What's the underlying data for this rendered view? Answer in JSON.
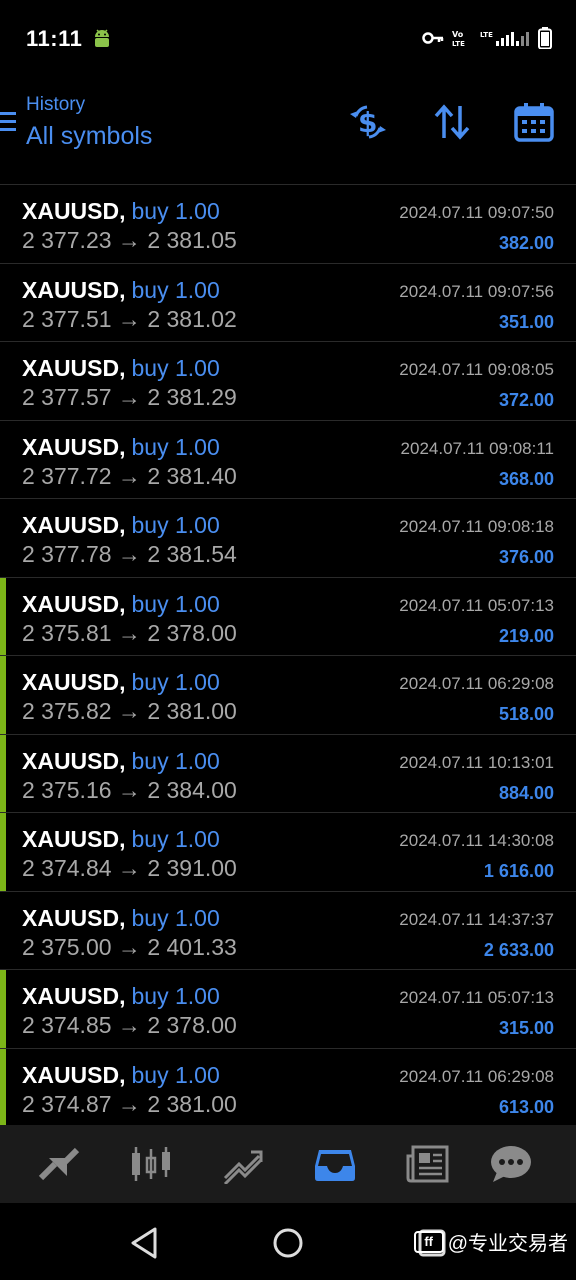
{
  "status_bar": {
    "time": "11:11",
    "icons": [
      "android-debug-icon",
      "vpn-key-icon",
      "volte-icon",
      "lte-signal-icon",
      "signal-bars-icon",
      "battery-icon"
    ],
    "volte_label": "Vo LTE",
    "lte_label": "LTE"
  },
  "header": {
    "subtitle": "History",
    "title": "All symbols",
    "actions": [
      "deposit-withdraw-icon",
      "sort-icon",
      "calendar-icon"
    ]
  },
  "colors": {
    "accent_blue": "#4a8ef0",
    "profit_blue": "#3d86ea",
    "accent_green": "#7cb518",
    "background": "#000000"
  },
  "trades": [
    {
      "symbol": "XAUUSD,",
      "direction": "buy 1.00",
      "open": "2 377.23",
      "close": "2 381.05",
      "datetime": "2024.07.11 09:07:50",
      "profit": "382.00",
      "marked": false
    },
    {
      "symbol": "XAUUSD,",
      "direction": "buy 1.00",
      "open": "2 377.51",
      "close": "2 381.02",
      "datetime": "2024.07.11 09:07:56",
      "profit": "351.00",
      "marked": false
    },
    {
      "symbol": "XAUUSD,",
      "direction": "buy 1.00",
      "open": "2 377.57",
      "close": "2 381.29",
      "datetime": "2024.07.11 09:08:05",
      "profit": "372.00",
      "marked": false
    },
    {
      "symbol": "XAUUSD,",
      "direction": "buy 1.00",
      "open": "2 377.72",
      "close": "2 381.40",
      "datetime": "2024.07.11 09:08:11",
      "profit": "368.00",
      "marked": false
    },
    {
      "symbol": "XAUUSD,",
      "direction": "buy 1.00",
      "open": "2 377.78",
      "close": "2 381.54",
      "datetime": "2024.07.11 09:08:18",
      "profit": "376.00",
      "marked": false
    },
    {
      "symbol": "XAUUSD,",
      "direction": "buy 1.00",
      "open": "2 375.81",
      "close": "2 378.00",
      "datetime": "2024.07.11 05:07:13",
      "profit": "219.00",
      "marked": true
    },
    {
      "symbol": "XAUUSD,",
      "direction": "buy 1.00",
      "open": "2 375.82",
      "close": "2 381.00",
      "datetime": "2024.07.11 06:29:08",
      "profit": "518.00",
      "marked": true
    },
    {
      "symbol": "XAUUSD,",
      "direction": "buy 1.00",
      "open": "2 375.16",
      "close": "2 384.00",
      "datetime": "2024.07.11 10:13:01",
      "profit": "884.00",
      "marked": true
    },
    {
      "symbol": "XAUUSD,",
      "direction": "buy 1.00",
      "open": "2 374.84",
      "close": "2 391.00",
      "datetime": "2024.07.11 14:30:08",
      "profit": "1 616.00",
      "marked": true
    },
    {
      "symbol": "XAUUSD,",
      "direction": "buy 1.00",
      "open": "2 375.00",
      "close": "2 401.33",
      "datetime": "2024.07.11 14:37:37",
      "profit": "2 633.00",
      "marked": false
    },
    {
      "symbol": "XAUUSD,",
      "direction": "buy 1.00",
      "open": "2 374.85",
      "close": "2 378.00",
      "datetime": "2024.07.11 05:07:13",
      "profit": "315.00",
      "marked": true
    },
    {
      "symbol": "XAUUSD,",
      "direction": "buy 1.00",
      "open": "2 374.87",
      "close": "2 381.00",
      "datetime": "2024.07.11 06:29:08",
      "profit": "613.00",
      "marked": true
    }
  ],
  "arrow": "→",
  "bottom_nav": {
    "items": [
      "quotes-icon",
      "chart-icon",
      "trade-icon",
      "history-icon",
      "news-icon",
      "chat-icon"
    ],
    "active": "history-icon"
  },
  "system_nav": [
    "back-icon",
    "home-icon",
    "recents-icon"
  ],
  "watermark": {
    "logo": "ff",
    "text": "@专业交易者"
  }
}
